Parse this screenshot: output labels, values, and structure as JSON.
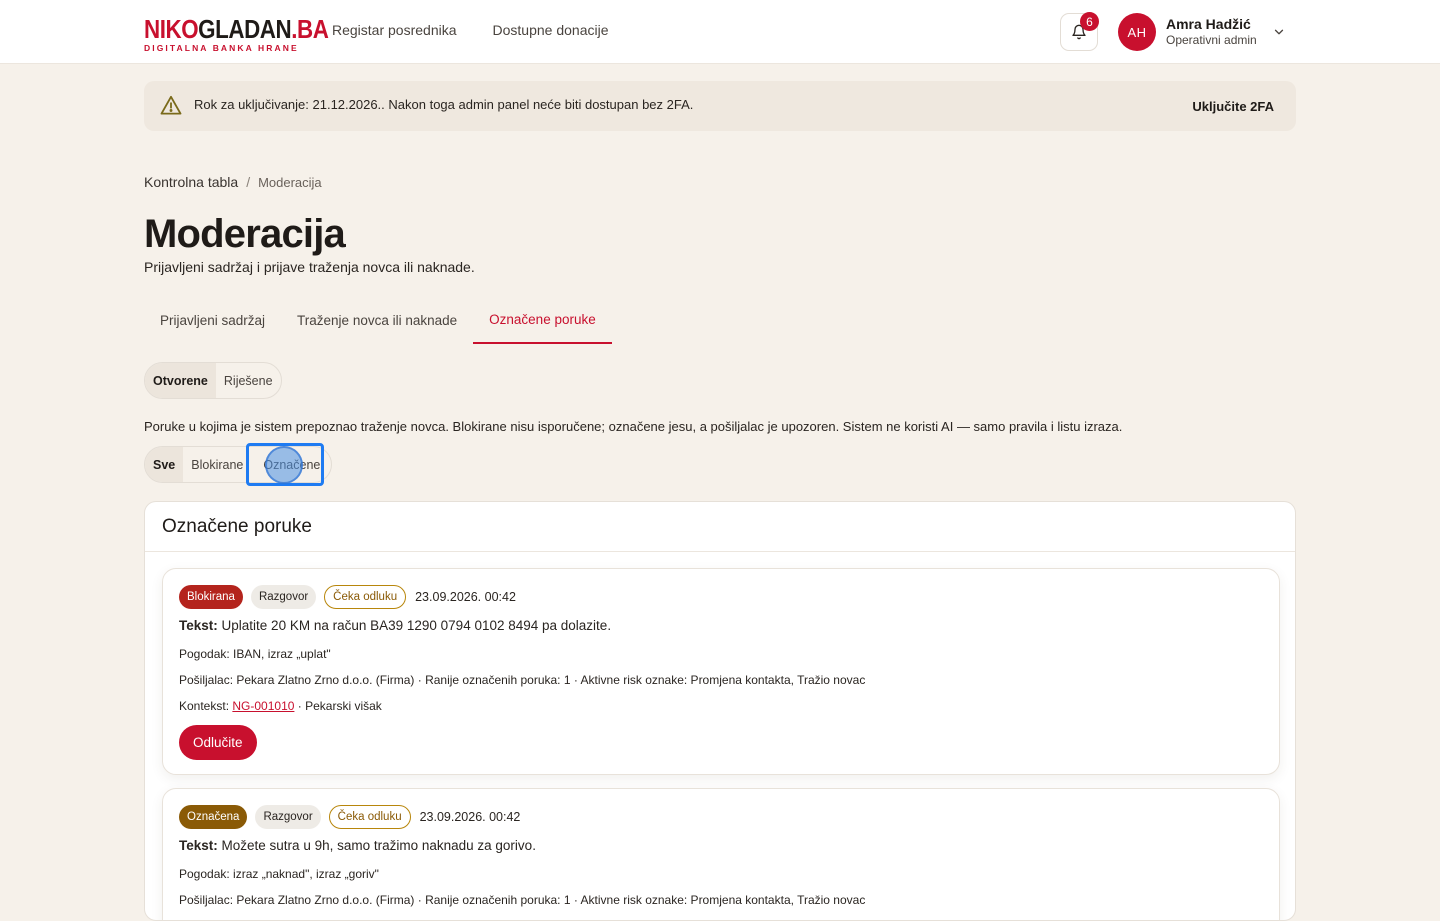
{
  "header": {
    "logo": {
      "part1": "NIKO",
      "part2": "GLADAN",
      "part3": ".BA",
      "tagline": "DIGITALNA BANKA HRANE"
    },
    "nav": [
      {
        "label": "Registar posrednika"
      },
      {
        "label": "Dostupne donacije"
      }
    ],
    "notifications_count": "6",
    "user": {
      "initials": "AH",
      "name": "Amra Hadžić",
      "role": "Operativni admin"
    }
  },
  "banner": {
    "text": "Rok za uključivanje: 21.12.2026.. Nakon toga admin panel neće biti dostupan bez 2FA.",
    "action": "Uključite 2FA"
  },
  "breadcrumb": {
    "parent": "Kontrolna tabla",
    "separator": "/",
    "current": "Moderacija"
  },
  "page": {
    "title": "Moderacija",
    "subtitle": "Prijavljeni sadržaj i prijave traženja novca ili naknade."
  },
  "tabs": [
    {
      "label": "Prijavljeni sadržaj",
      "active": false
    },
    {
      "label": "Traženje novca ili naknade",
      "active": false
    },
    {
      "label": "Označene poruke",
      "active": true
    }
  ],
  "status_filter": [
    {
      "label": "Otvorene",
      "active": true
    },
    {
      "label": "Riješene",
      "active": false
    }
  ],
  "info_text": "Poruke u kojima je sistem prepoznao traženje novca. Blokirane nisu isporučene; označene jesu, a pošiljalac je upozoren. Sistem ne koristi AI — samo pravila i listu izraza.",
  "type_filter": [
    {
      "label": "Sve",
      "active": true
    },
    {
      "label": "Blokirane",
      "active": false
    },
    {
      "label": "Označene",
      "active": false
    }
  ],
  "panel": {
    "title": "Označene poruke",
    "messages": [
      {
        "status": "Blokirana",
        "channel": "Razgovor",
        "decision": "Čeka odluku",
        "date": "23.09.2026. 00:42",
        "text_label": "Tekst:",
        "text": "Uplatite 20 KM na račun BA39 1290 0794 0102 8494 pa dolazite.",
        "match": "Pogodak: IBAN, izraz „uplat\"",
        "sender": "Pošiljalac: Pekara Zlatno Zrno d.o.o. (Firma) · Ranije označenih poruka: 1 · Aktivne risk oznake: Promjena kontakta, Tražio novac",
        "context_label": "Kontekst:",
        "context_id": "NG-001010",
        "context_rest": "· Pekarski višak",
        "action": "Odlučite"
      },
      {
        "status": "Označena",
        "channel": "Razgovor",
        "decision": "Čeka odluku",
        "date": "23.09.2026. 00:42",
        "text_label": "Tekst:",
        "text": "Možete sutra u 9h, samo tražimo naknadu za gorivo.",
        "match": "Pogodak: izraz „naknad\", izraz „goriv\"",
        "sender": "Pošiljalac: Pekara Zlatno Zrno d.o.o. (Firma) · Ranije označenih poruka: 1 · Aktivne risk oznake: Promjena kontakta, Tražio novac"
      }
    ]
  }
}
